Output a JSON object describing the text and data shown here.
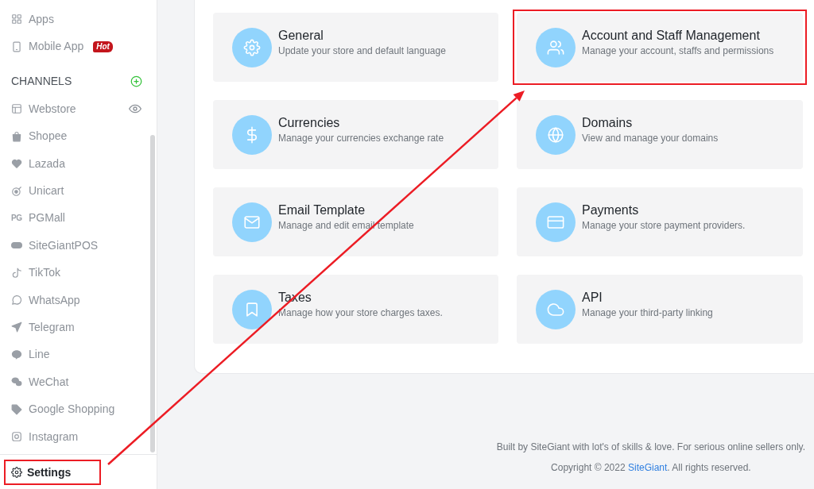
{
  "sidebar": {
    "items": [
      {
        "label": "Apps"
      },
      {
        "label": "Mobile App",
        "badge": "Hot"
      }
    ],
    "channels_heading": "CHANNELS",
    "channels": [
      {
        "label": "Webstore",
        "preview": true
      },
      {
        "label": "Shopee",
        "preview": false
      },
      {
        "label": "Lazada",
        "preview": false
      },
      {
        "label": "Unicart",
        "preview": false
      },
      {
        "label": "PGMall",
        "preview": false,
        "logo_text": "PG"
      },
      {
        "label": "SiteGiantPOS",
        "preview": false
      },
      {
        "label": "TikTok",
        "preview": false
      },
      {
        "label": "WhatsApp",
        "preview": false
      },
      {
        "label": "Telegram",
        "preview": false
      },
      {
        "label": "Line",
        "preview": false
      },
      {
        "label": "WeChat",
        "preview": false
      },
      {
        "label": "Google Shopping",
        "preview": false
      },
      {
        "label": "Instagram",
        "preview": false
      }
    ],
    "footer": {
      "label": "Settings",
      "highlighted": true
    }
  },
  "cards": [
    {
      "title": "General",
      "description": "Update your store and default language",
      "highlighted": false
    },
    {
      "title": "Account and Staff Management",
      "description": "Manage your account, staffs and permissions",
      "highlighted": true
    },
    {
      "title": "Currencies",
      "description": "Manage your currencies exchange rate",
      "highlighted": false
    },
    {
      "title": "Domains",
      "description": "View and manage your domains",
      "highlighted": false
    },
    {
      "title": "Email Template",
      "description": "Manage and edit email template",
      "highlighted": false
    },
    {
      "title": "Payments",
      "description": "Manage your store payment providers.",
      "highlighted": false
    },
    {
      "title": "Taxes",
      "description": "Manage how your store charges taxes.",
      "highlighted": false
    },
    {
      "title": "API",
      "description": "Manage your third-party linking",
      "highlighted": false
    }
  ],
  "footer": {
    "tagline": "Built by SiteGiant with lot's of skills & love. For serious online sellers only.",
    "copyright_before": "Copyright © 2022",
    "copyright_link": "SiteGiant",
    "copyright_after": ". All rights reserved."
  }
}
